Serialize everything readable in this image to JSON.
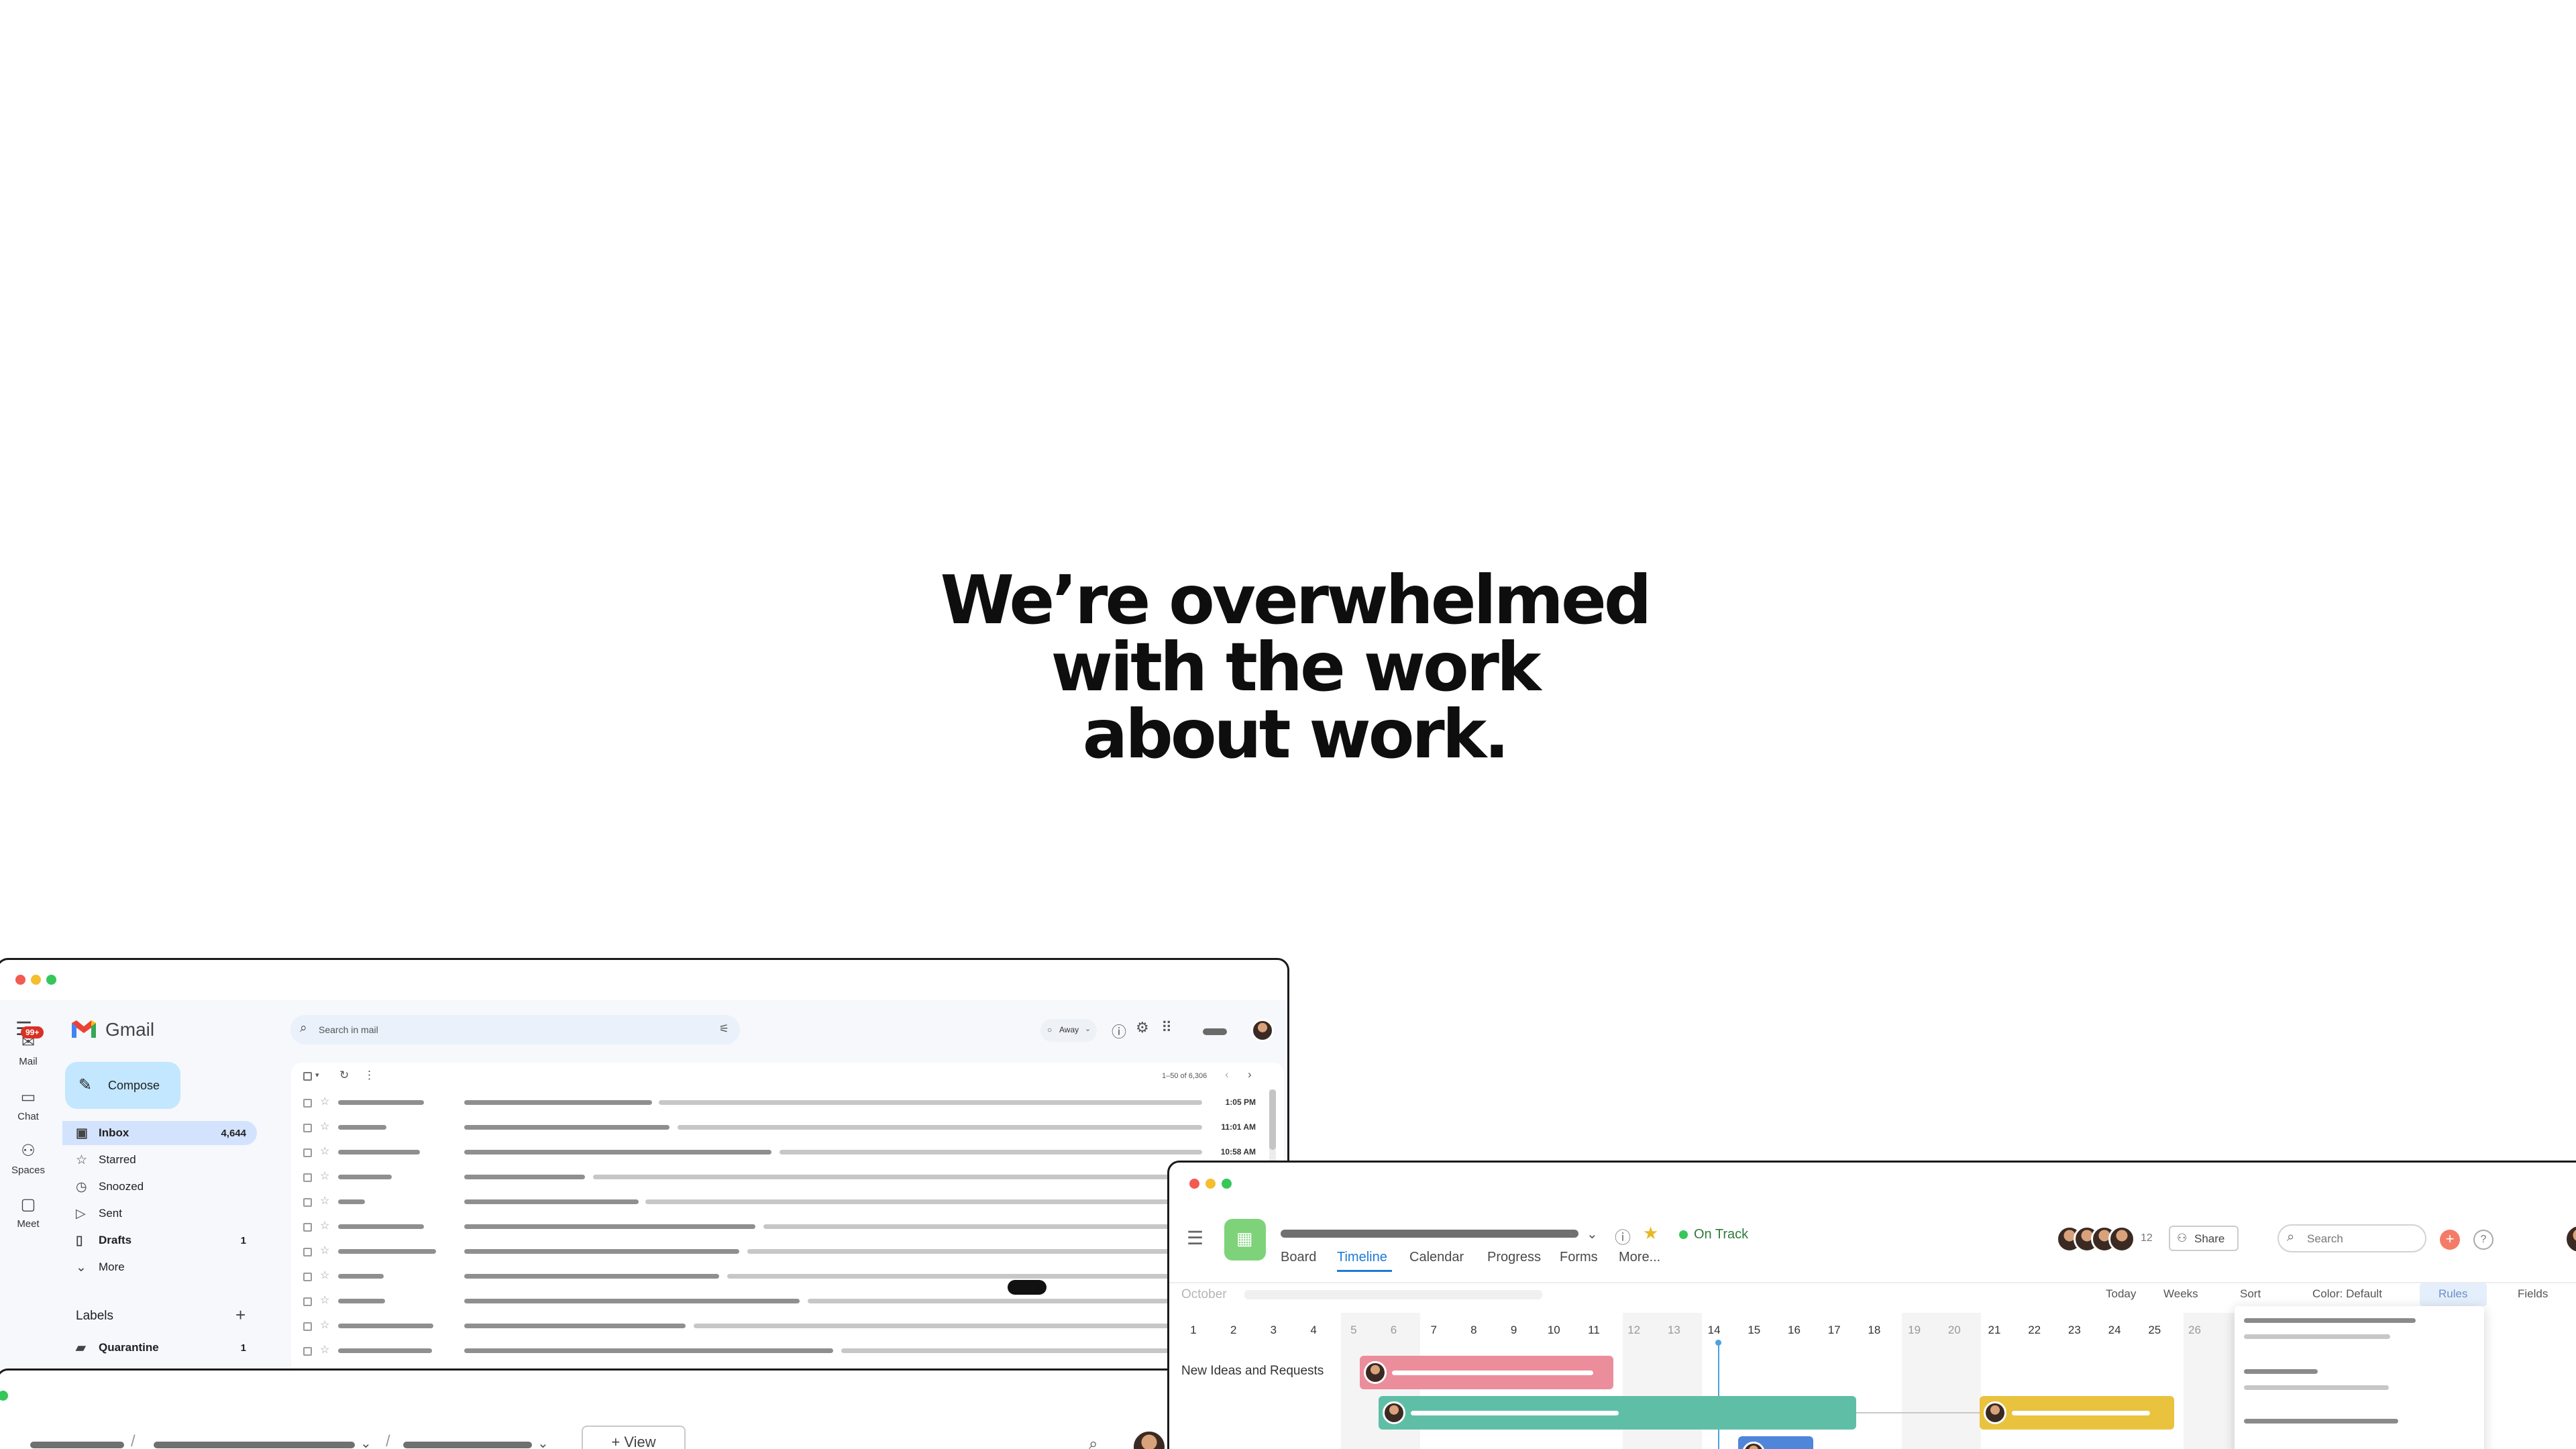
{
  "headline": {
    "line1": "We’re overwhelmed",
    "line2": "with the work",
    "line3": "about work."
  },
  "gmail": {
    "app_name": "Gmail",
    "search_placeholder": "Search in mail",
    "status": "Away",
    "compose_label": "Compose",
    "rail": {
      "mail": "Mail",
      "mail_badge": "99+",
      "chat": "Chat",
      "spaces": "Spaces",
      "meet": "Meet"
    },
    "nav": [
      {
        "label": "Inbox",
        "count": "4,644"
      },
      {
        "label": "Starred",
        "count": ""
      },
      {
        "label": "Snoozed",
        "count": ""
      },
      {
        "label": "Sent",
        "count": ""
      },
      {
        "label": "Drafts",
        "count": "1"
      },
      {
        "label": "More",
        "count": ""
      }
    ],
    "labels_heading": "Labels",
    "labels": [
      {
        "label": "Quarantine",
        "count": "1"
      }
    ],
    "pagination": "1–50 of 6,306",
    "times": [
      "1:05 PM",
      "11:01 AM",
      "10:58 AM"
    ]
  },
  "project": {
    "status": "On Track",
    "tabs": [
      "Board",
      "Timeline",
      "Calendar",
      "Progress",
      "Forms",
      "More..."
    ],
    "member_count": "12",
    "share_label": "Share",
    "search_placeholder": "Search",
    "month": "October",
    "controls": {
      "today": "Today",
      "weeks": "Weeks",
      "sort": "Sort",
      "color": "Color: Default",
      "rules": "Rules",
      "fields": "Fields"
    },
    "days": [
      "1",
      "2",
      "3",
      "4",
      "5",
      "6",
      "7",
      "8",
      "9",
      "10",
      "11",
      "12",
      "13",
      "14",
      "15",
      "16",
      "17",
      "18",
      "19",
      "20",
      "21",
      "22",
      "23",
      "24",
      "25",
      "26"
    ],
    "row_label": "New Ideas and Requests",
    "colors": {
      "pink": "#ec8d9c",
      "teal": "#5fbfa6",
      "yellow": "#e9c23e",
      "blue": "#4f86d9",
      "accent": "#1e7ad6"
    }
  },
  "bottom": {
    "view_label": "+ View"
  }
}
